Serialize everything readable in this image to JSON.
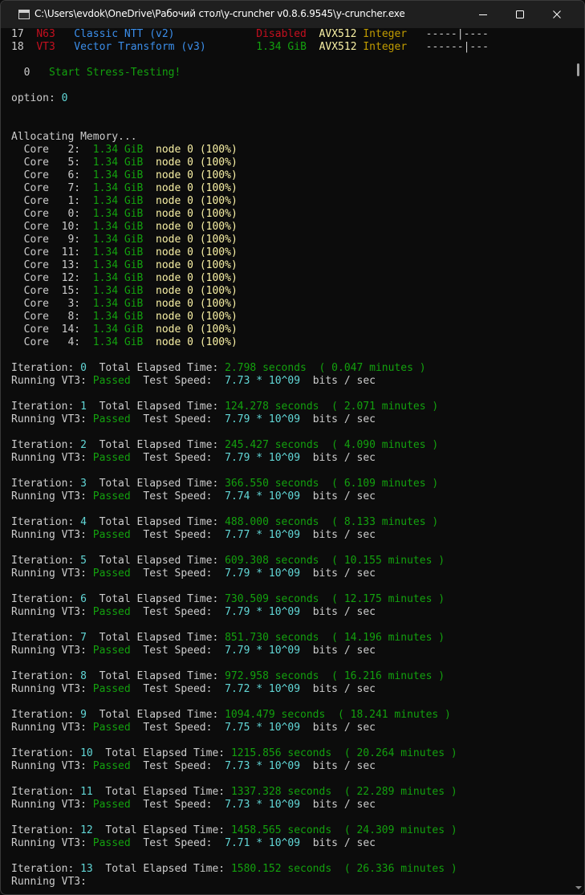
{
  "window": {
    "title": "C:\\Users\\evdok\\OneDrive\\Рабочий стол\\y-cruncher v0.8.6.9545\\y-cruncher.exe"
  },
  "console": {
    "lines": [
      [
        {
          "t": "17  ",
          "c": "gray"
        },
        {
          "t": "N63",
          "c": "red"
        },
        {
          "t": "   ",
          "c": "gray"
        },
        {
          "t": "Classic NTT (v2)",
          "c": "blue"
        },
        {
          "t": "             ",
          "c": "gray"
        },
        {
          "t": "Disabled",
          "c": "red"
        },
        {
          "t": "  ",
          "c": "gray"
        },
        {
          "t": "AVX512",
          "c": "yellow"
        },
        {
          "t": " ",
          "c": "gray"
        },
        {
          "t": "Integer",
          "c": "orange"
        },
        {
          "t": "   -----|----",
          "c": "gray"
        }
      ],
      [
        {
          "t": "18  ",
          "c": "gray"
        },
        {
          "t": "VT3",
          "c": "red"
        },
        {
          "t": "   ",
          "c": "gray"
        },
        {
          "t": "Vector Transform (v3)",
          "c": "blue"
        },
        {
          "t": "        ",
          "c": "gray"
        },
        {
          "t": "1.34 GiB",
          "c": "green"
        },
        {
          "t": "  ",
          "c": "gray"
        },
        {
          "t": "AVX512",
          "c": "yellow"
        },
        {
          "t": " ",
          "c": "gray"
        },
        {
          "t": "Integer",
          "c": "orange"
        },
        {
          "t": "   ------|---",
          "c": "gray"
        }
      ],
      [],
      [
        {
          "t": "  0   ",
          "c": "gray"
        },
        {
          "t": "Start Stress-Testing!",
          "c": "green"
        }
      ],
      [],
      [
        {
          "t": "option: ",
          "c": "gray"
        },
        {
          "t": "0",
          "c": "cyan"
        }
      ],
      [],
      [],
      [
        {
          "t": "Allocating Memory...",
          "c": "gray"
        }
      ],
      [
        {
          "t": "  Core   2:  ",
          "c": "gray"
        },
        {
          "t": "1.34 GiB",
          "c": "green"
        },
        {
          "t": "  ",
          "c": "gray"
        },
        {
          "t": "node 0 (100%)",
          "c": "yellow"
        }
      ],
      [
        {
          "t": "  Core   5:  ",
          "c": "gray"
        },
        {
          "t": "1.34 GiB",
          "c": "green"
        },
        {
          "t": "  ",
          "c": "gray"
        },
        {
          "t": "node 0 (100%)",
          "c": "yellow"
        }
      ],
      [
        {
          "t": "  Core   6:  ",
          "c": "gray"
        },
        {
          "t": "1.34 GiB",
          "c": "green"
        },
        {
          "t": "  ",
          "c": "gray"
        },
        {
          "t": "node 0 (100%)",
          "c": "yellow"
        }
      ],
      [
        {
          "t": "  Core   7:  ",
          "c": "gray"
        },
        {
          "t": "1.34 GiB",
          "c": "green"
        },
        {
          "t": "  ",
          "c": "gray"
        },
        {
          "t": "node 0 (100%)",
          "c": "yellow"
        }
      ],
      [
        {
          "t": "  Core   1:  ",
          "c": "gray"
        },
        {
          "t": "1.34 GiB",
          "c": "green"
        },
        {
          "t": "  ",
          "c": "gray"
        },
        {
          "t": "node 0 (100%)",
          "c": "yellow"
        }
      ],
      [
        {
          "t": "  Core   0:  ",
          "c": "gray"
        },
        {
          "t": "1.34 GiB",
          "c": "green"
        },
        {
          "t": "  ",
          "c": "gray"
        },
        {
          "t": "node 0 (100%)",
          "c": "yellow"
        }
      ],
      [
        {
          "t": "  Core  10:  ",
          "c": "gray"
        },
        {
          "t": "1.34 GiB",
          "c": "green"
        },
        {
          "t": "  ",
          "c": "gray"
        },
        {
          "t": "node 0 (100%)",
          "c": "yellow"
        }
      ],
      [
        {
          "t": "  Core   9:  ",
          "c": "gray"
        },
        {
          "t": "1.34 GiB",
          "c": "green"
        },
        {
          "t": "  ",
          "c": "gray"
        },
        {
          "t": "node 0 (100%)",
          "c": "yellow"
        }
      ],
      [
        {
          "t": "  Core  11:  ",
          "c": "gray"
        },
        {
          "t": "1.34 GiB",
          "c": "green"
        },
        {
          "t": "  ",
          "c": "gray"
        },
        {
          "t": "node 0 (100%)",
          "c": "yellow"
        }
      ],
      [
        {
          "t": "  Core  13:  ",
          "c": "gray"
        },
        {
          "t": "1.34 GiB",
          "c": "green"
        },
        {
          "t": "  ",
          "c": "gray"
        },
        {
          "t": "node 0 (100%)",
          "c": "yellow"
        }
      ],
      [
        {
          "t": "  Core  12:  ",
          "c": "gray"
        },
        {
          "t": "1.34 GiB",
          "c": "green"
        },
        {
          "t": "  ",
          "c": "gray"
        },
        {
          "t": "node 0 (100%)",
          "c": "yellow"
        }
      ],
      [
        {
          "t": "  Core  15:  ",
          "c": "gray"
        },
        {
          "t": "1.34 GiB",
          "c": "green"
        },
        {
          "t": "  ",
          "c": "gray"
        },
        {
          "t": "node 0 (100%)",
          "c": "yellow"
        }
      ],
      [
        {
          "t": "  Core   3:  ",
          "c": "gray"
        },
        {
          "t": "1.34 GiB",
          "c": "green"
        },
        {
          "t": "  ",
          "c": "gray"
        },
        {
          "t": "node 0 (100%)",
          "c": "yellow"
        }
      ],
      [
        {
          "t": "  Core   8:  ",
          "c": "gray"
        },
        {
          "t": "1.34 GiB",
          "c": "green"
        },
        {
          "t": "  ",
          "c": "gray"
        },
        {
          "t": "node 0 (100%)",
          "c": "yellow"
        }
      ],
      [
        {
          "t": "  Core  14:  ",
          "c": "gray"
        },
        {
          "t": "1.34 GiB",
          "c": "green"
        },
        {
          "t": "  ",
          "c": "gray"
        },
        {
          "t": "node 0 (100%)",
          "c": "yellow"
        }
      ],
      [
        {
          "t": "  Core   4:  ",
          "c": "gray"
        },
        {
          "t": "1.34 GiB",
          "c": "green"
        },
        {
          "t": "  ",
          "c": "gray"
        },
        {
          "t": "node 0 (100%)",
          "c": "yellow"
        }
      ],
      [],
      [
        {
          "t": "Iteration: ",
          "c": "gray"
        },
        {
          "t": "0",
          "c": "cyan"
        },
        {
          "t": "  Total Elapsed Time: ",
          "c": "gray"
        },
        {
          "t": "2.798 seconds  ( 0.047 minutes )",
          "c": "green"
        }
      ],
      [
        {
          "t": "Running VT3: ",
          "c": "gray"
        },
        {
          "t": "Passed",
          "c": "green"
        },
        {
          "t": "  Test Speed:  ",
          "c": "gray"
        },
        {
          "t": "7.73 * 10^09",
          "c": "cyan"
        },
        {
          "t": "  bits / sec",
          "c": "gray"
        }
      ],
      [],
      [
        {
          "t": "Iteration: ",
          "c": "gray"
        },
        {
          "t": "1",
          "c": "cyan"
        },
        {
          "t": "  Total Elapsed Time: ",
          "c": "gray"
        },
        {
          "t": "124.278 seconds  ( 2.071 minutes )",
          "c": "green"
        }
      ],
      [
        {
          "t": "Running VT3: ",
          "c": "gray"
        },
        {
          "t": "Passed",
          "c": "green"
        },
        {
          "t": "  Test Speed:  ",
          "c": "gray"
        },
        {
          "t": "7.79 * 10^09",
          "c": "cyan"
        },
        {
          "t": "  bits / sec",
          "c": "gray"
        }
      ],
      [],
      [
        {
          "t": "Iteration: ",
          "c": "gray"
        },
        {
          "t": "2",
          "c": "cyan"
        },
        {
          "t": "  Total Elapsed Time: ",
          "c": "gray"
        },
        {
          "t": "245.427 seconds  ( 4.090 minutes )",
          "c": "green"
        }
      ],
      [
        {
          "t": "Running VT3: ",
          "c": "gray"
        },
        {
          "t": "Passed",
          "c": "green"
        },
        {
          "t": "  Test Speed:  ",
          "c": "gray"
        },
        {
          "t": "7.79 * 10^09",
          "c": "cyan"
        },
        {
          "t": "  bits / sec",
          "c": "gray"
        }
      ],
      [],
      [
        {
          "t": "Iteration: ",
          "c": "gray"
        },
        {
          "t": "3",
          "c": "cyan"
        },
        {
          "t": "  Total Elapsed Time: ",
          "c": "gray"
        },
        {
          "t": "366.550 seconds  ( 6.109 minutes )",
          "c": "green"
        }
      ],
      [
        {
          "t": "Running VT3: ",
          "c": "gray"
        },
        {
          "t": "Passed",
          "c": "green"
        },
        {
          "t": "  Test Speed:  ",
          "c": "gray"
        },
        {
          "t": "7.74 * 10^09",
          "c": "cyan"
        },
        {
          "t": "  bits / sec",
          "c": "gray"
        }
      ],
      [],
      [
        {
          "t": "Iteration: ",
          "c": "gray"
        },
        {
          "t": "4",
          "c": "cyan"
        },
        {
          "t": "  Total Elapsed Time: ",
          "c": "gray"
        },
        {
          "t": "488.000 seconds  ( 8.133 minutes )",
          "c": "green"
        }
      ],
      [
        {
          "t": "Running VT3: ",
          "c": "gray"
        },
        {
          "t": "Passed",
          "c": "green"
        },
        {
          "t": "  Test Speed:  ",
          "c": "gray"
        },
        {
          "t": "7.77 * 10^09",
          "c": "cyan"
        },
        {
          "t": "  bits / sec",
          "c": "gray"
        }
      ],
      [],
      [
        {
          "t": "Iteration: ",
          "c": "gray"
        },
        {
          "t": "5",
          "c": "cyan"
        },
        {
          "t": "  Total Elapsed Time: ",
          "c": "gray"
        },
        {
          "t": "609.308 seconds  ( 10.155 minutes )",
          "c": "green"
        }
      ],
      [
        {
          "t": "Running VT3: ",
          "c": "gray"
        },
        {
          "t": "Passed",
          "c": "green"
        },
        {
          "t": "  Test Speed:  ",
          "c": "gray"
        },
        {
          "t": "7.79 * 10^09",
          "c": "cyan"
        },
        {
          "t": "  bits / sec",
          "c": "gray"
        }
      ],
      [],
      [
        {
          "t": "Iteration: ",
          "c": "gray"
        },
        {
          "t": "6",
          "c": "cyan"
        },
        {
          "t": "  Total Elapsed Time: ",
          "c": "gray"
        },
        {
          "t": "730.509 seconds  ( 12.175 minutes )",
          "c": "green"
        }
      ],
      [
        {
          "t": "Running VT3: ",
          "c": "gray"
        },
        {
          "t": "Passed",
          "c": "green"
        },
        {
          "t": "  Test Speed:  ",
          "c": "gray"
        },
        {
          "t": "7.79 * 10^09",
          "c": "cyan"
        },
        {
          "t": "  bits / sec",
          "c": "gray"
        }
      ],
      [],
      [
        {
          "t": "Iteration: ",
          "c": "gray"
        },
        {
          "t": "7",
          "c": "cyan"
        },
        {
          "t": "  Total Elapsed Time: ",
          "c": "gray"
        },
        {
          "t": "851.730 seconds  ( 14.196 minutes )",
          "c": "green"
        }
      ],
      [
        {
          "t": "Running VT3: ",
          "c": "gray"
        },
        {
          "t": "Passed",
          "c": "green"
        },
        {
          "t": "  Test Speed:  ",
          "c": "gray"
        },
        {
          "t": "7.79 * 10^09",
          "c": "cyan"
        },
        {
          "t": "  bits / sec",
          "c": "gray"
        }
      ],
      [],
      [
        {
          "t": "Iteration: ",
          "c": "gray"
        },
        {
          "t": "8",
          "c": "cyan"
        },
        {
          "t": "  Total Elapsed Time: ",
          "c": "gray"
        },
        {
          "t": "972.958 seconds  ( 16.216 minutes )",
          "c": "green"
        }
      ],
      [
        {
          "t": "Running VT3: ",
          "c": "gray"
        },
        {
          "t": "Passed",
          "c": "green"
        },
        {
          "t": "  Test Speed:  ",
          "c": "gray"
        },
        {
          "t": "7.72 * 10^09",
          "c": "cyan"
        },
        {
          "t": "  bits / sec",
          "c": "gray"
        }
      ],
      [],
      [
        {
          "t": "Iteration: ",
          "c": "gray"
        },
        {
          "t": "9",
          "c": "cyan"
        },
        {
          "t": "  Total Elapsed Time: ",
          "c": "gray"
        },
        {
          "t": "1094.479 seconds  ( 18.241 minutes )",
          "c": "green"
        }
      ],
      [
        {
          "t": "Running VT3: ",
          "c": "gray"
        },
        {
          "t": "Passed",
          "c": "green"
        },
        {
          "t": "  Test Speed:  ",
          "c": "gray"
        },
        {
          "t": "7.75 * 10^09",
          "c": "cyan"
        },
        {
          "t": "  bits / sec",
          "c": "gray"
        }
      ],
      [],
      [
        {
          "t": "Iteration: ",
          "c": "gray"
        },
        {
          "t": "10",
          "c": "cyan"
        },
        {
          "t": "  Total Elapsed Time: ",
          "c": "gray"
        },
        {
          "t": "1215.856 seconds  ( 20.264 minutes )",
          "c": "green"
        }
      ],
      [
        {
          "t": "Running VT3: ",
          "c": "gray"
        },
        {
          "t": "Passed",
          "c": "green"
        },
        {
          "t": "  Test Speed:  ",
          "c": "gray"
        },
        {
          "t": "7.73 * 10^09",
          "c": "cyan"
        },
        {
          "t": "  bits / sec",
          "c": "gray"
        }
      ],
      [],
      [
        {
          "t": "Iteration: ",
          "c": "gray"
        },
        {
          "t": "11",
          "c": "cyan"
        },
        {
          "t": "  Total Elapsed Time: ",
          "c": "gray"
        },
        {
          "t": "1337.328 seconds  ( 22.289 minutes )",
          "c": "green"
        }
      ],
      [
        {
          "t": "Running VT3: ",
          "c": "gray"
        },
        {
          "t": "Passed",
          "c": "green"
        },
        {
          "t": "  Test Speed:  ",
          "c": "gray"
        },
        {
          "t": "7.73 * 10^09",
          "c": "cyan"
        },
        {
          "t": "  bits / sec",
          "c": "gray"
        }
      ],
      [],
      [
        {
          "t": "Iteration: ",
          "c": "gray"
        },
        {
          "t": "12",
          "c": "cyan"
        },
        {
          "t": "  Total Elapsed Time: ",
          "c": "gray"
        },
        {
          "t": "1458.565 seconds  ( 24.309 minutes )",
          "c": "green"
        }
      ],
      [
        {
          "t": "Running VT3: ",
          "c": "gray"
        },
        {
          "t": "Passed",
          "c": "green"
        },
        {
          "t": "  Test Speed:  ",
          "c": "gray"
        },
        {
          "t": "7.71 * 10^09",
          "c": "cyan"
        },
        {
          "t": "  bits / sec",
          "c": "gray"
        }
      ],
      [],
      [
        {
          "t": "Iteration: ",
          "c": "gray"
        },
        {
          "t": "13",
          "c": "cyan"
        },
        {
          "t": "  Total Elapsed Time: ",
          "c": "gray"
        },
        {
          "t": "1580.152 seconds  ( 26.336 minutes )",
          "c": "green"
        }
      ],
      [
        {
          "t": "Running VT3:",
          "c": "gray"
        }
      ]
    ]
  },
  "colors": {
    "background": "#0c0c0c",
    "titlebar": "#1f1f1f",
    "default_text": "#cccccc",
    "green": "#13a10e",
    "red": "#c50f1f",
    "blue": "#3b8eea",
    "yellow": "#f9f1a5",
    "cyan": "#61d6d6",
    "orange": "#c19c00"
  },
  "icons": {
    "app": "console-icon",
    "minimize": "minimize-icon",
    "maximize": "maximize-icon",
    "close": "close-icon"
  }
}
